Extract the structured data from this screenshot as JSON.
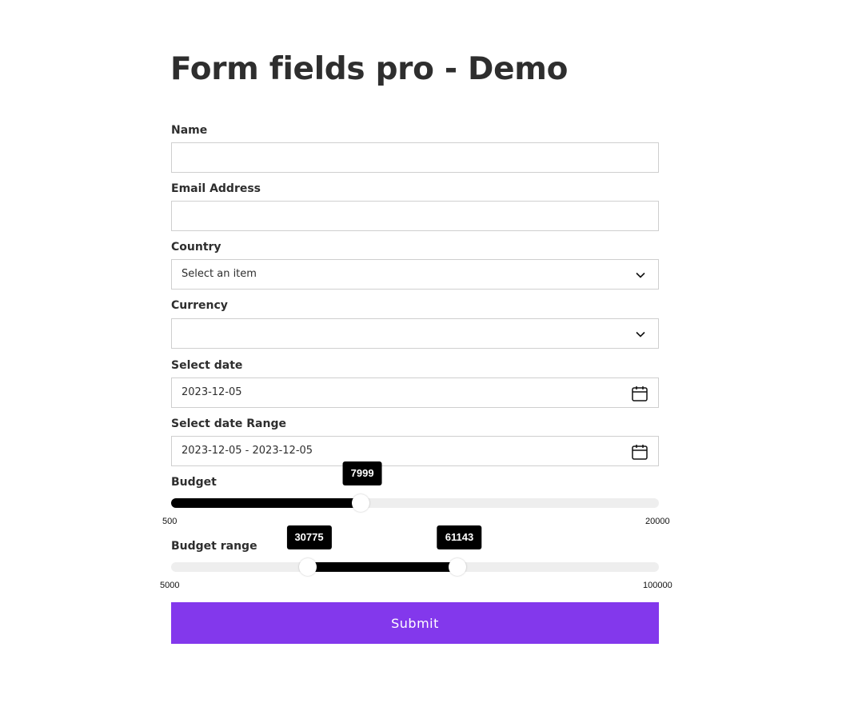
{
  "page": {
    "title": "Form fields pro - Demo"
  },
  "form": {
    "name": {
      "label": "Name",
      "value": ""
    },
    "email": {
      "label": "Email Address",
      "value": ""
    },
    "country": {
      "label": "Country",
      "selected": "Select an item"
    },
    "currency": {
      "label": "Currency",
      "selected": ""
    },
    "date": {
      "label": "Select date",
      "value": "2023-12-05",
      "icon": "calendar-icon"
    },
    "date_range": {
      "label": "Select date Range",
      "value": "2023-12-05 - 2023-12-05",
      "icon": "calendar-icon"
    },
    "budget": {
      "label": "Budget",
      "min": 500,
      "max": 20000,
      "min_label": "500",
      "max_label": "20000",
      "value": 7999,
      "value_label": "7999"
    },
    "budget_range": {
      "label": "Budget range",
      "min": 5000,
      "max": 100000,
      "min_label": "5000",
      "max_label": "100000",
      "low": 30775,
      "high": 61143,
      "low_label": "30775",
      "high_label": "61143"
    },
    "submit_label": "Submit"
  },
  "colors": {
    "accent": "#8338ec",
    "slider_fill": "#000000",
    "slider_track": "#eeeeee",
    "tooltip_bg": "#000000"
  }
}
